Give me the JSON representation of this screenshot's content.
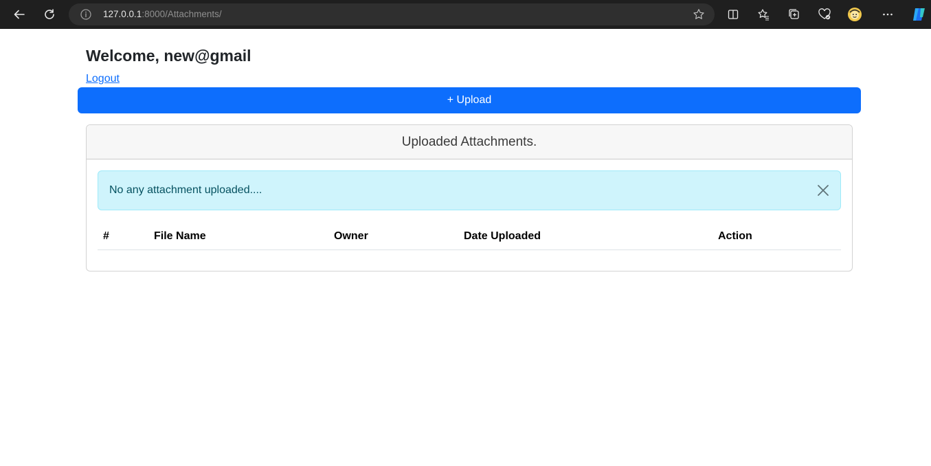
{
  "browser": {
    "url_host": "127.0.0.1",
    "url_path": ":8000/Attachments/"
  },
  "page": {
    "welcome": "Welcome, new@gmail",
    "logout_label": "Logout",
    "upload_label": "+ Upload"
  },
  "card": {
    "title": "Uploaded Attachments.",
    "alert_message": "No any attachment uploaded...."
  },
  "table": {
    "columns": [
      "#",
      "File Name",
      "Owner",
      "Date Uploaded",
      "Action"
    ],
    "rows": []
  },
  "colors": {
    "primary": "#0d6efd",
    "alert_bg": "#cff4fc",
    "alert_text": "#055160",
    "browser_bar": "#1f1f1f"
  }
}
